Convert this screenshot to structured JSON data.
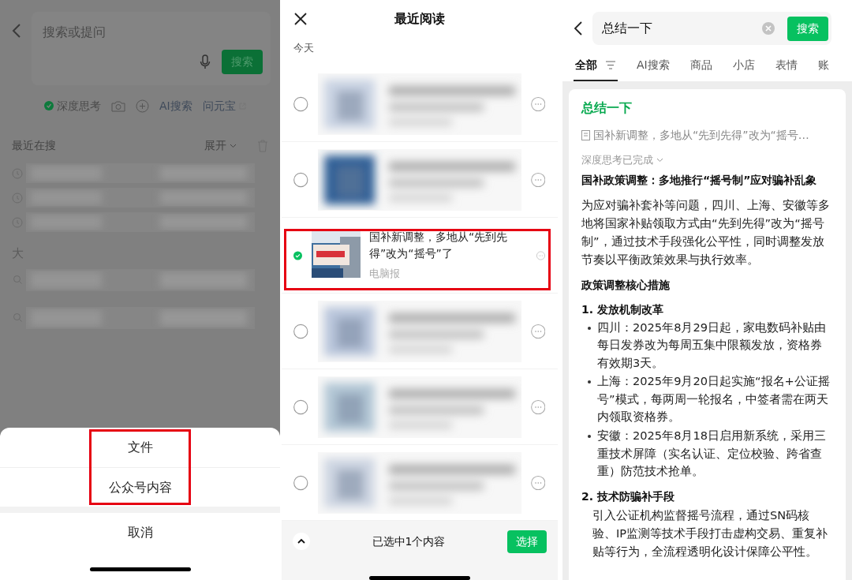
{
  "search_screen": {
    "placeholder": "搜索或提问",
    "search_button": "搜索",
    "options": [
      {
        "kind": "toggle",
        "label": "深度思考",
        "checked": true
      },
      {
        "kind": "camera"
      },
      {
        "kind": "plus"
      },
      {
        "kind": "text",
        "label": "AI搜索"
      },
      {
        "kind": "link",
        "label": "问元宝"
      }
    ],
    "recent_title": "最近在搜",
    "expand": "展开",
    "history": [
      {
        "kind": "clock"
      },
      {
        "kind": "clock"
      },
      {
        "kind": "clock"
      }
    ],
    "section_label": "大",
    "suggestions": [
      {
        "kind": "search"
      },
      {
        "kind": "search"
      }
    ],
    "sheet": {
      "options_highlighted": true,
      "options": [
        "文件",
        "公众号内容"
      ],
      "cancel": "取消"
    }
  },
  "recent_reading": {
    "title": "最近阅读",
    "day_label": "今天",
    "items": [
      {
        "kind": "blurred",
        "selected": false,
        "highlighted": false
      },
      {
        "kind": "blurred",
        "selected": false,
        "highlighted": false
      },
      {
        "kind": "article",
        "selected": true,
        "highlighted": true,
        "title": "国补新调整，多地从“先到先得”改为“摇号”了",
        "source": "电脑报"
      },
      {
        "kind": "blurred",
        "selected": false,
        "highlighted": false
      },
      {
        "kind": "blurred",
        "selected": false,
        "highlighted": false
      },
      {
        "kind": "blurred",
        "selected": false,
        "highlighted": false
      }
    ],
    "footer": {
      "count": "已选中1个内容",
      "button": "选择"
    }
  },
  "search_results": {
    "query": "总结一下",
    "search_button": "搜索",
    "tabs": [
      {
        "label": "全部",
        "selected": true,
        "filter": true
      },
      {
        "label": "AI搜索",
        "selected": false,
        "filter": false
      },
      {
        "label": "商品",
        "selected": false,
        "filter": false
      },
      {
        "label": "小店",
        "selected": false,
        "filter": false
      },
      {
        "label": "表情",
        "selected": false,
        "filter": false
      },
      {
        "label": "账",
        "selected": false,
        "filter": false
      }
    ],
    "answer": {
      "title": "总结一下",
      "source": "国补新调整，多地从“先到先得”改为“摇号…",
      "status": "深度思考已完成",
      "heading": "国补政策调整：多地推行“摇号制”应对骗补乱象",
      "intro": "为应对骗补套补等问题，四川、上海、安徽等多地将国家补贴领取方式由“先到先得”改为“摇号制”，通过技术手段强化公平性，同时调整发放节奏以平衡政策效果与执行效率。",
      "section": "政策调整核心措施",
      "points": [
        {
          "title": "1. 发放机制改革",
          "bullets": [
            "四川：2025年8月29日起，家电数码补贴由每日发券改为每周五集中限额发放，资格券有效期3天。",
            "上海：2025年9月20日起实施“报名+公证摇号”模式，每两周一轮报名，中签者需在两天内领取资格券。",
            "安徽：2025年8月18日启用新系统，采用三重技术屏障（实名认证、定位校验、跨省查重）防范技术抢单。"
          ]
        },
        {
          "title": "2. 技术防骗补手段",
          "text": "引入公证机构监督摇号流程，通过SN码核验、IP监测等技术手段打击虚构交易、重复补贴等行为，全流程透明化设计保障公平性。"
        }
      ]
    }
  }
}
